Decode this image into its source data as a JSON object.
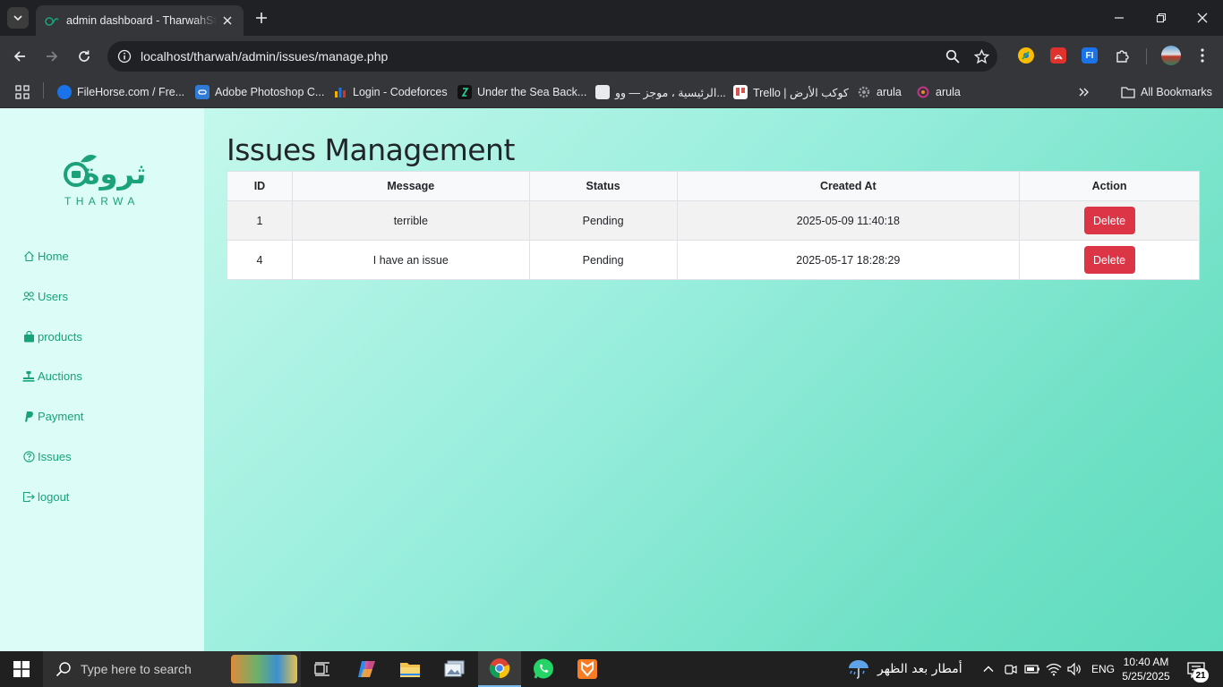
{
  "browser": {
    "tab_title": "admin dashboard - TharwahStore",
    "url": "localhost/tharwah/admin/issues/manage.php",
    "bookmarks": [
      {
        "label": "FileHorse.com / Fre...",
        "color": "#1a73e8"
      },
      {
        "label": "Adobe Photoshop C...",
        "color": "#2f7bd6"
      },
      {
        "label": "Login - Codeforces",
        "color": "#f0b400"
      },
      {
        "label": "Under the Sea Back...",
        "color": "#111111"
      },
      {
        "label": "الرئيسية ، موجز — وو...",
        "color": "#e8eaed"
      },
      {
        "label": "Trello | كوكب الأرض",
        "color": "#d9534f"
      },
      {
        "label": "arula",
        "color": "#9aa0a6"
      },
      {
        "label": "arula",
        "color": "#c13584"
      }
    ],
    "all_bookmarks": "All Bookmarks",
    "extensions": [
      {
        "icon": "chrome-ext-icon",
        "color": "#fbbc04"
      },
      {
        "icon": "acrobat-ext-icon",
        "color": "#e0322d"
      },
      {
        "icon": "fi-ext-icon",
        "color": "#1a73e8",
        "text": "FI"
      }
    ]
  },
  "sidebar": {
    "logo_text": "ثروة",
    "logo_sub": "THARWA",
    "items": [
      {
        "label": "Home",
        "icon": "house-icon"
      },
      {
        "label": "Users",
        "icon": "people-icon"
      },
      {
        "label": "products",
        "icon": "bag-icon"
      },
      {
        "label": "Auctions",
        "icon": "auction-icon"
      },
      {
        "label": "Payment",
        "icon": "paypal-icon"
      },
      {
        "label": "Issues",
        "icon": "question-circle-icon"
      },
      {
        "label": "logout",
        "icon": "logout-icon"
      }
    ]
  },
  "main": {
    "title": "Issues Management",
    "table": {
      "headers": [
        "ID",
        "Message",
        "Status",
        "Created At",
        "Action"
      ],
      "rows": [
        {
          "id": "1",
          "message": "terrible",
          "status": "Pending",
          "created_at": "2025-05-09 11:40:18",
          "action": "Delete"
        },
        {
          "id": "4",
          "message": "I have an issue",
          "status": "Pending",
          "created_at": "2025-05-17 18:28:29",
          "action": "Delete"
        }
      ]
    }
  },
  "taskbar": {
    "search_placeholder": "Type here to search",
    "weather": "أمطار بعد الظهر",
    "language": "ENG",
    "time": "10:40 AM",
    "date": "5/25/2025",
    "notifications": "21"
  },
  "colors": {
    "accent": "#17a27a",
    "delete": "#dc3545",
    "sidebar_bg": "#dcfcf8"
  }
}
